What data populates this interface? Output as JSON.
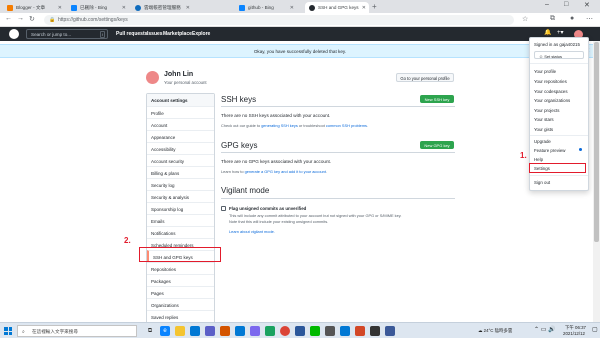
{
  "browser": {
    "tabs": [
      {
        "label": "Blogger - 文章",
        "color": "#f57c00"
      },
      {
        "label": "已刪除 - Bing",
        "color": "#0a84ff"
      },
      {
        "label": "雲端帳密管理服務",
        "color": "#0f6cbd"
      },
      {
        "label": "github - Bing",
        "color": "#0a84ff"
      },
      {
        "label": "SSH and GPG keys",
        "color": "#24292f"
      }
    ],
    "new_tab": "+",
    "url": "https://github.com/settings/keys",
    "window_controls": [
      "–",
      "□",
      "✕"
    ]
  },
  "gh_header": {
    "search_placeholder": "Search or jump to...",
    "search_key": "/",
    "nav": [
      "Pull requests",
      "Issues",
      "Marketplace",
      "Explore"
    ],
    "icons": [
      "bell-icon",
      "plus-icon",
      "avatar"
    ]
  },
  "flash": {
    "message": "Okay, you have successfully deleted that key.",
    "close": "✕"
  },
  "profile": {
    "name": "John Lin",
    "subtitle": "Your personal account",
    "button": "Go to your personal profile"
  },
  "settings_menu": [
    "Account settings",
    "Profile",
    "Account",
    "Appearance",
    "Accessibility",
    "Account security",
    "Billing & plans",
    "Security log",
    "Security & analysis",
    "Sponsorship log",
    "Emails",
    "Notifications",
    "Scheduled reminders",
    "SSH and GPG keys",
    "Repositories",
    "Packages",
    "Pages",
    "Organizations",
    "Saved replies",
    "Applications"
  ],
  "ssh": {
    "title": "SSH keys",
    "button": "New SSH key",
    "empty": "There are no SSH keys associated with your account.",
    "help_pre": "Check out our guide to ",
    "help_link": "generating SSH keys",
    "help_mid": " or troubleshoot ",
    "help_link2": "common SSH problems",
    "help_end": "."
  },
  "gpg": {
    "title": "GPG keys",
    "button": "New GPG key",
    "empty": "There are no GPG keys associated with your account.",
    "help_pre": "Learn how to ",
    "help_link": "generate a GPG key and add it to your account",
    "help_end": "."
  },
  "vigilant": {
    "title": "Vigilant mode",
    "checkbox_label": "Flag unsigned commits as unverified",
    "desc1": "This will include any commit attributed to your account but not signed with your GPG or S/MIME key.",
    "desc2": "Note that this will include your existing unsigned commits.",
    "link": "Learn about vigilant mode."
  },
  "dropdown": {
    "signed_in": "Signed in as gaja40215",
    "set_status": "Set status",
    "items": [
      "Your profile",
      "Your repositories",
      "Your codespaces",
      "Your organizations",
      "Your projects",
      "Your stars",
      "Your gists"
    ],
    "items2": [
      "Upgrade",
      "Feature preview",
      "Help",
      "Settings"
    ],
    "sign_out": "Sign out"
  },
  "annotations": {
    "one": "1.",
    "two": "2."
  },
  "annotation_color": "#e21b2c",
  "taskbar": {
    "search_placeholder": "在這裡輸入文字來搜尋",
    "weather": "24°C 陰時多雲",
    "time": "下午 06:37",
    "date": "2021/12/12"
  }
}
